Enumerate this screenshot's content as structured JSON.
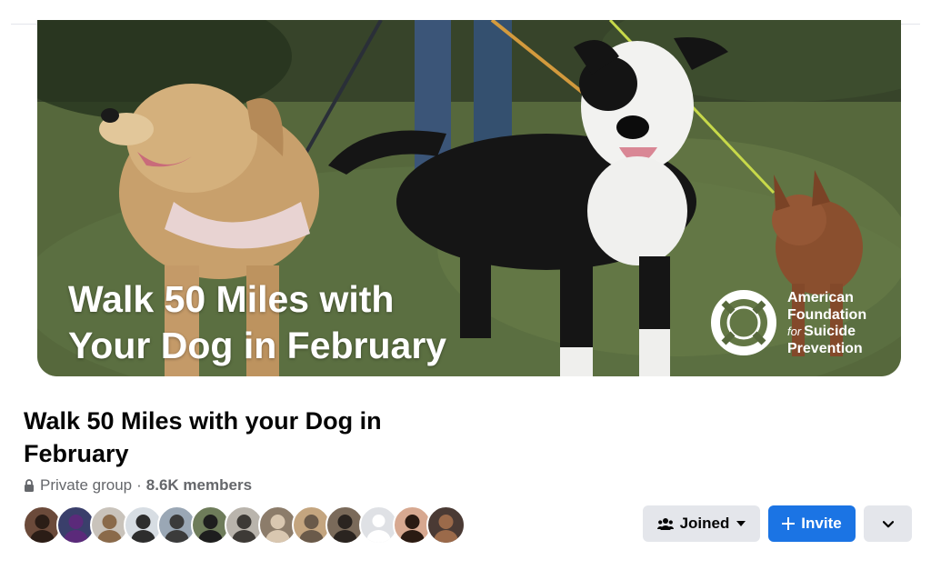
{
  "cover": {
    "headline_line1": "Walk 50 Miles with",
    "headline_line2": "Your Dog in February",
    "org": {
      "line1": "American",
      "line2": "Foundation",
      "line3_prefix": "for",
      "line3": "Suicide",
      "line4": "Prevention"
    }
  },
  "group": {
    "title": "Walk 50 Miles with your Dog in February",
    "privacy": "Private group",
    "separator": "·",
    "members": "8.6K members"
  },
  "member_avatars": [
    {
      "name": "member-avatar-1",
      "bg": "#6b4a3a",
      "fg": "#2b1d16"
    },
    {
      "name": "member-avatar-2",
      "bg": "#3a3f6b",
      "fg": "#5b2a7a"
    },
    {
      "name": "member-avatar-3",
      "bg": "#c9c3bb",
      "fg": "#8a6a4a"
    },
    {
      "name": "member-avatar-4",
      "bg": "#d7dde3",
      "fg": "#2d2d2d"
    },
    {
      "name": "member-avatar-5",
      "bg": "#9aa7b5",
      "fg": "#3b3b3b"
    },
    {
      "name": "member-avatar-6",
      "bg": "#6e7c5a",
      "fg": "#1e1e1e"
    },
    {
      "name": "member-avatar-7",
      "bg": "#b9b4ac",
      "fg": "#3d3a36"
    },
    {
      "name": "member-avatar-8",
      "bg": "#8c7c6a",
      "fg": "#d9c7b0"
    },
    {
      "name": "member-avatar-9",
      "bg": "#c4a57f",
      "fg": "#6a5a4a"
    },
    {
      "name": "member-avatar-10",
      "bg": "#7a6a5a",
      "fg": "#2a2420"
    },
    {
      "name": "member-avatar-default",
      "bg": "#dfe1e5",
      "fg": "#ffffff",
      "default": true
    },
    {
      "name": "member-avatar-12",
      "bg": "#d7a890",
      "fg": "#2a1a12"
    },
    {
      "name": "member-avatar-13",
      "bg": "#4a3a34",
      "fg": "#9b6a4a"
    }
  ],
  "actions": {
    "joined_label": "Joined",
    "invite_label": "Invite",
    "more_icon": "chevron-down-icon"
  },
  "colors": {
    "primary": "#1b74e4",
    "secondary_btn": "#e4e6eb",
    "text": "#050505",
    "muted": "#65676b"
  }
}
